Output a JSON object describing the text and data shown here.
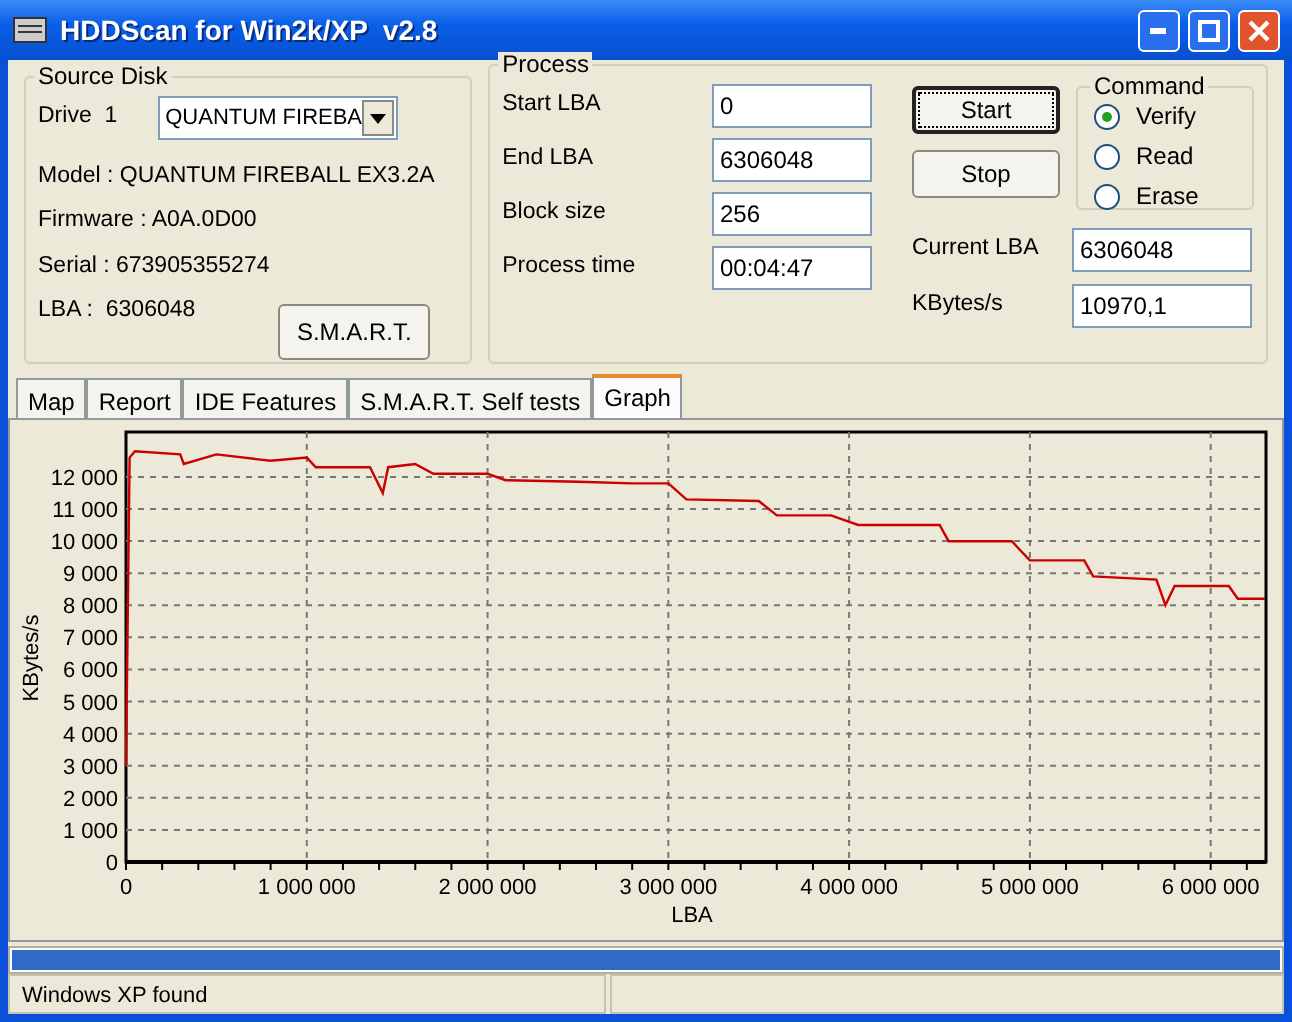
{
  "window": {
    "title": "HDDScan for Win2k/XP  v2.8"
  },
  "source_disk": {
    "title": "Source Disk",
    "drive_label": "Drive  1",
    "drive_value": "QUANTUM FIREBA",
    "info": [
      "Model : QUANTUM FIREBALL EX3.2A",
      "Firmware : A0A.0D00",
      "Serial : 673905355274",
      "LBA :  6306048"
    ],
    "smart_button": "S.M.A.R.T."
  },
  "process": {
    "title": "Process",
    "fields": [
      {
        "label": "Start LBA",
        "value": "0"
      },
      {
        "label": "End LBA",
        "value": "6306048"
      },
      {
        "label": "Block size",
        "value": "256"
      },
      {
        "label": "Process time",
        "value": "00:04:47"
      }
    ],
    "buttons": [
      {
        "label": "Start",
        "focused": true
      },
      {
        "label": "Stop",
        "focused": false
      }
    ],
    "readouts": [
      {
        "label": "Current LBA",
        "value": "6306048"
      },
      {
        "label": "KBytes/s",
        "value": "10970,1"
      }
    ]
  },
  "command": {
    "title": "Command",
    "options": [
      {
        "label": "Verify",
        "selected": true
      },
      {
        "label": "Read",
        "selected": false
      },
      {
        "label": "Erase",
        "selected": false
      }
    ]
  },
  "tabs": [
    {
      "label": "Map",
      "selected": false
    },
    {
      "label": "Report",
      "selected": false
    },
    {
      "label": "IDE Features",
      "selected": false
    },
    {
      "label": "S.M.A.R.T. Self tests",
      "selected": false
    },
    {
      "label": "Graph",
      "selected": true
    }
  ],
  "graph": {
    "chart_data": {
      "type": "line",
      "xlabel": "LBA",
      "ylabel": "KBytes/s",
      "xlim": [
        0,
        6306048
      ],
      "ylim": [
        0,
        13400
      ],
      "xticks": [
        {
          "value": 0,
          "label": "0"
        },
        {
          "value": 1000000,
          "label": "1 000 000"
        },
        {
          "value": 2000000,
          "label": "2 000 000"
        },
        {
          "value": 3000000,
          "label": "3 000 000"
        },
        {
          "value": 4000000,
          "label": "4 000 000"
        },
        {
          "value": 5000000,
          "label": "5 000 000"
        },
        {
          "value": 6000000,
          "label": "6 000 000"
        }
      ],
      "yticks": [
        {
          "value": 0,
          "label": "0"
        },
        {
          "value": 1000,
          "label": "1 000"
        },
        {
          "value": 2000,
          "label": "2 000"
        },
        {
          "value": 3000,
          "label": "3 000"
        },
        {
          "value": 4000,
          "label": "4 000"
        },
        {
          "value": 5000,
          "label": "5 000"
        },
        {
          "value": 6000,
          "label": "6 000"
        },
        {
          "value": 7000,
          "label": "7 000"
        },
        {
          "value": 8000,
          "label": "8 000"
        },
        {
          "value": 9000,
          "label": "9 000"
        },
        {
          "value": 10000,
          "label": "10 000"
        },
        {
          "value": 11000,
          "label": "11 000"
        },
        {
          "value": 12000,
          "label": "12 000"
        }
      ],
      "x": [
        0,
        20000,
        50000,
        300000,
        320000,
        500000,
        800000,
        1000000,
        1050000,
        1350000,
        1420000,
        1450000,
        1600000,
        1700000,
        2000000,
        2100000,
        2500000,
        2800000,
        3000000,
        3100000,
        3500000,
        3600000,
        3900000,
        4050000,
        4500000,
        4550000,
        4900000,
        5000000,
        5300000,
        5350000,
        5700000,
        5750000,
        5800000,
        6100000,
        6150000,
        6300000
      ],
      "grid": true,
      "series": [
        {
          "color": "#cc0000",
          "values": [
            3000,
            12600,
            12800,
            12700,
            12400,
            12700,
            12500,
            12600,
            12300,
            12300,
            11500,
            12300,
            12400,
            12100,
            12100,
            11900,
            11850,
            11800,
            11800,
            11300,
            11250,
            10800,
            10800,
            10500,
            10500,
            10000,
            10000,
            9400,
            9400,
            8900,
            8800,
            8000,
            8600,
            8600,
            8200,
            8200
          ]
        }
      ]
    }
  },
  "progress": {
    "level": 1
  },
  "status_bar": {
    "text": "Windows XP found"
  }
}
